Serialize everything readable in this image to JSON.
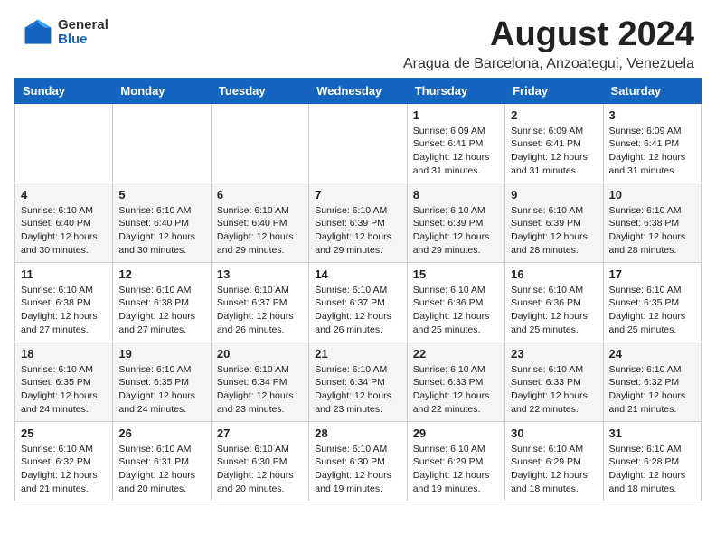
{
  "logo": {
    "general": "General",
    "blue": "Blue"
  },
  "title": {
    "month_year": "August 2024",
    "location": "Aragua de Barcelona, Anzoategui, Venezuela"
  },
  "weekdays": [
    "Sunday",
    "Monday",
    "Tuesday",
    "Wednesday",
    "Thursday",
    "Friday",
    "Saturday"
  ],
  "weeks": [
    [
      {
        "day": "",
        "info": ""
      },
      {
        "day": "",
        "info": ""
      },
      {
        "day": "",
        "info": ""
      },
      {
        "day": "",
        "info": ""
      },
      {
        "day": "1",
        "info": "Sunrise: 6:09 AM\nSunset: 6:41 PM\nDaylight: 12 hours\nand 31 minutes."
      },
      {
        "day": "2",
        "info": "Sunrise: 6:09 AM\nSunset: 6:41 PM\nDaylight: 12 hours\nand 31 minutes."
      },
      {
        "day": "3",
        "info": "Sunrise: 6:09 AM\nSunset: 6:41 PM\nDaylight: 12 hours\nand 31 minutes."
      }
    ],
    [
      {
        "day": "4",
        "info": "Sunrise: 6:10 AM\nSunset: 6:40 PM\nDaylight: 12 hours\nand 30 minutes."
      },
      {
        "day": "5",
        "info": "Sunrise: 6:10 AM\nSunset: 6:40 PM\nDaylight: 12 hours\nand 30 minutes."
      },
      {
        "day": "6",
        "info": "Sunrise: 6:10 AM\nSunset: 6:40 PM\nDaylight: 12 hours\nand 29 minutes."
      },
      {
        "day": "7",
        "info": "Sunrise: 6:10 AM\nSunset: 6:39 PM\nDaylight: 12 hours\nand 29 minutes."
      },
      {
        "day": "8",
        "info": "Sunrise: 6:10 AM\nSunset: 6:39 PM\nDaylight: 12 hours\nand 29 minutes."
      },
      {
        "day": "9",
        "info": "Sunrise: 6:10 AM\nSunset: 6:39 PM\nDaylight: 12 hours\nand 28 minutes."
      },
      {
        "day": "10",
        "info": "Sunrise: 6:10 AM\nSunset: 6:38 PM\nDaylight: 12 hours\nand 28 minutes."
      }
    ],
    [
      {
        "day": "11",
        "info": "Sunrise: 6:10 AM\nSunset: 6:38 PM\nDaylight: 12 hours\nand 27 minutes."
      },
      {
        "day": "12",
        "info": "Sunrise: 6:10 AM\nSunset: 6:38 PM\nDaylight: 12 hours\nand 27 minutes."
      },
      {
        "day": "13",
        "info": "Sunrise: 6:10 AM\nSunset: 6:37 PM\nDaylight: 12 hours\nand 26 minutes."
      },
      {
        "day": "14",
        "info": "Sunrise: 6:10 AM\nSunset: 6:37 PM\nDaylight: 12 hours\nand 26 minutes."
      },
      {
        "day": "15",
        "info": "Sunrise: 6:10 AM\nSunset: 6:36 PM\nDaylight: 12 hours\nand 25 minutes."
      },
      {
        "day": "16",
        "info": "Sunrise: 6:10 AM\nSunset: 6:36 PM\nDaylight: 12 hours\nand 25 minutes."
      },
      {
        "day": "17",
        "info": "Sunrise: 6:10 AM\nSunset: 6:35 PM\nDaylight: 12 hours\nand 25 minutes."
      }
    ],
    [
      {
        "day": "18",
        "info": "Sunrise: 6:10 AM\nSunset: 6:35 PM\nDaylight: 12 hours\nand 24 minutes."
      },
      {
        "day": "19",
        "info": "Sunrise: 6:10 AM\nSunset: 6:35 PM\nDaylight: 12 hours\nand 24 minutes."
      },
      {
        "day": "20",
        "info": "Sunrise: 6:10 AM\nSunset: 6:34 PM\nDaylight: 12 hours\nand 23 minutes."
      },
      {
        "day": "21",
        "info": "Sunrise: 6:10 AM\nSunset: 6:34 PM\nDaylight: 12 hours\nand 23 minutes."
      },
      {
        "day": "22",
        "info": "Sunrise: 6:10 AM\nSunset: 6:33 PM\nDaylight: 12 hours\nand 22 minutes."
      },
      {
        "day": "23",
        "info": "Sunrise: 6:10 AM\nSunset: 6:33 PM\nDaylight: 12 hours\nand 22 minutes."
      },
      {
        "day": "24",
        "info": "Sunrise: 6:10 AM\nSunset: 6:32 PM\nDaylight: 12 hours\nand 21 minutes."
      }
    ],
    [
      {
        "day": "25",
        "info": "Sunrise: 6:10 AM\nSunset: 6:32 PM\nDaylight: 12 hours\nand 21 minutes."
      },
      {
        "day": "26",
        "info": "Sunrise: 6:10 AM\nSunset: 6:31 PM\nDaylight: 12 hours\nand 20 minutes."
      },
      {
        "day": "27",
        "info": "Sunrise: 6:10 AM\nSunset: 6:30 PM\nDaylight: 12 hours\nand 20 minutes."
      },
      {
        "day": "28",
        "info": "Sunrise: 6:10 AM\nSunset: 6:30 PM\nDaylight: 12 hours\nand 19 minutes."
      },
      {
        "day": "29",
        "info": "Sunrise: 6:10 AM\nSunset: 6:29 PM\nDaylight: 12 hours\nand 19 minutes."
      },
      {
        "day": "30",
        "info": "Sunrise: 6:10 AM\nSunset: 6:29 PM\nDaylight: 12 hours\nand 18 minutes."
      },
      {
        "day": "31",
        "info": "Sunrise: 6:10 AM\nSunset: 6:28 PM\nDaylight: 12 hours\nand 18 minutes."
      }
    ]
  ]
}
